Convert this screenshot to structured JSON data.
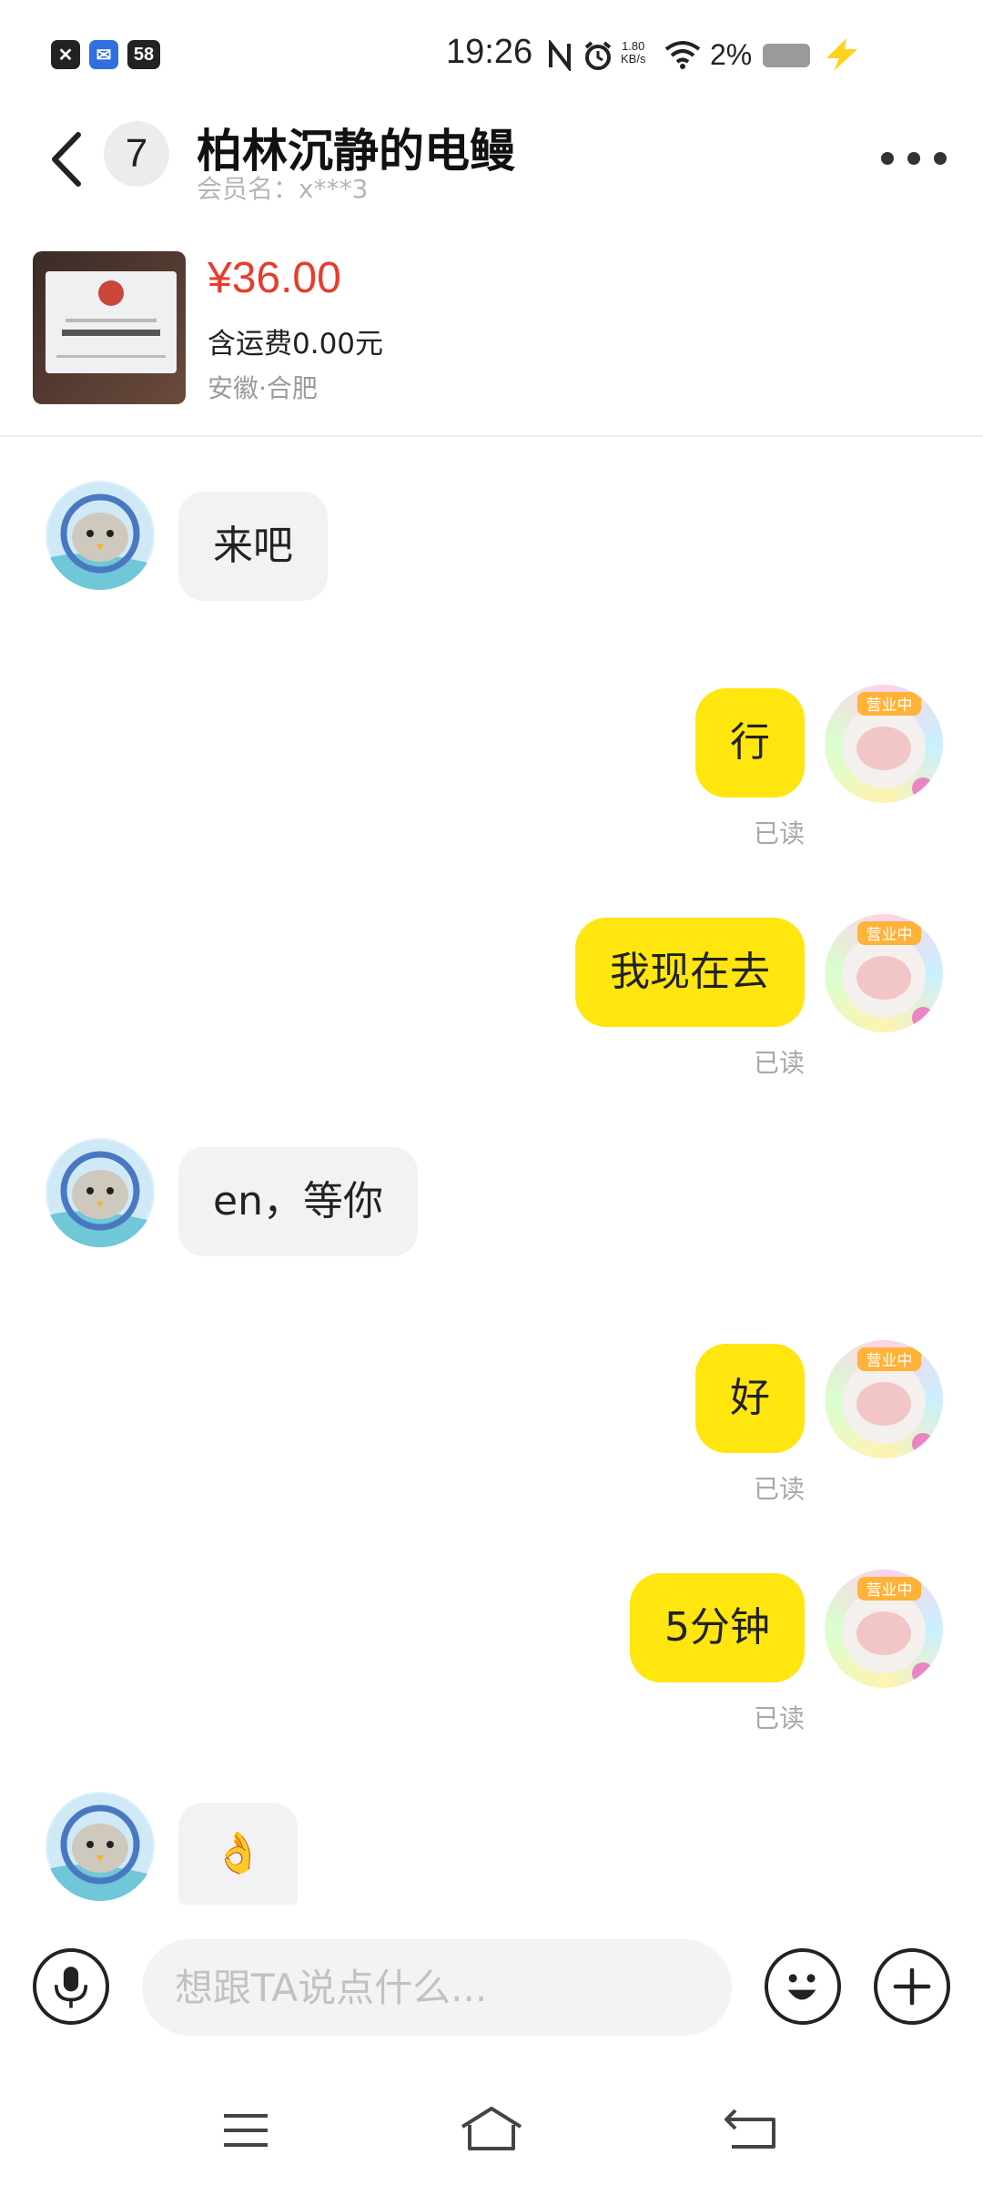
{
  "status_bar": {
    "time": "19:26",
    "app_badge_58": "58",
    "net_speed_value": "1.80",
    "net_speed_unit": "KB/s",
    "battery_percent": "2%",
    "icons": [
      "close-app-icon",
      "mail-app-icon",
      "58-app-icon",
      "nfc-icon",
      "alarm-icon",
      "wifi-icon",
      "battery-icon",
      "charging-icon"
    ]
  },
  "header": {
    "back_icon": "chevron-left-icon",
    "unread_count": "7",
    "title": "柏林沉静的电鳗",
    "member_name": "会员名：x***3",
    "more_icon": "more-dots-icon"
  },
  "product": {
    "price": "¥36.00",
    "shipping": "含运费0.00元",
    "location": "安徽·合肥"
  },
  "messages": [
    {
      "from": "other",
      "text": "来吧"
    },
    {
      "from": "me",
      "text": "行",
      "status": "已读"
    },
    {
      "from": "me",
      "text": "我现在去",
      "status": "已读"
    },
    {
      "from": "other",
      "text": "en，等你"
    },
    {
      "from": "me",
      "text": "好",
      "status": "已读"
    },
    {
      "from": "me",
      "text": "5分钟",
      "status": "已读"
    },
    {
      "from": "other",
      "text": "👌"
    }
  ],
  "avatar_badge_text": "营业中",
  "input": {
    "placeholder": "想跟TA说点什么...",
    "value": ""
  },
  "nav_bar": {
    "icons": [
      "menu-icon",
      "home-icon",
      "back-icon"
    ]
  },
  "colors": {
    "my_bubble": "#ffe60f",
    "other_bubble": "#f2f2f4",
    "price": "#e83c2b",
    "read_status": "#a8a8a8"
  }
}
